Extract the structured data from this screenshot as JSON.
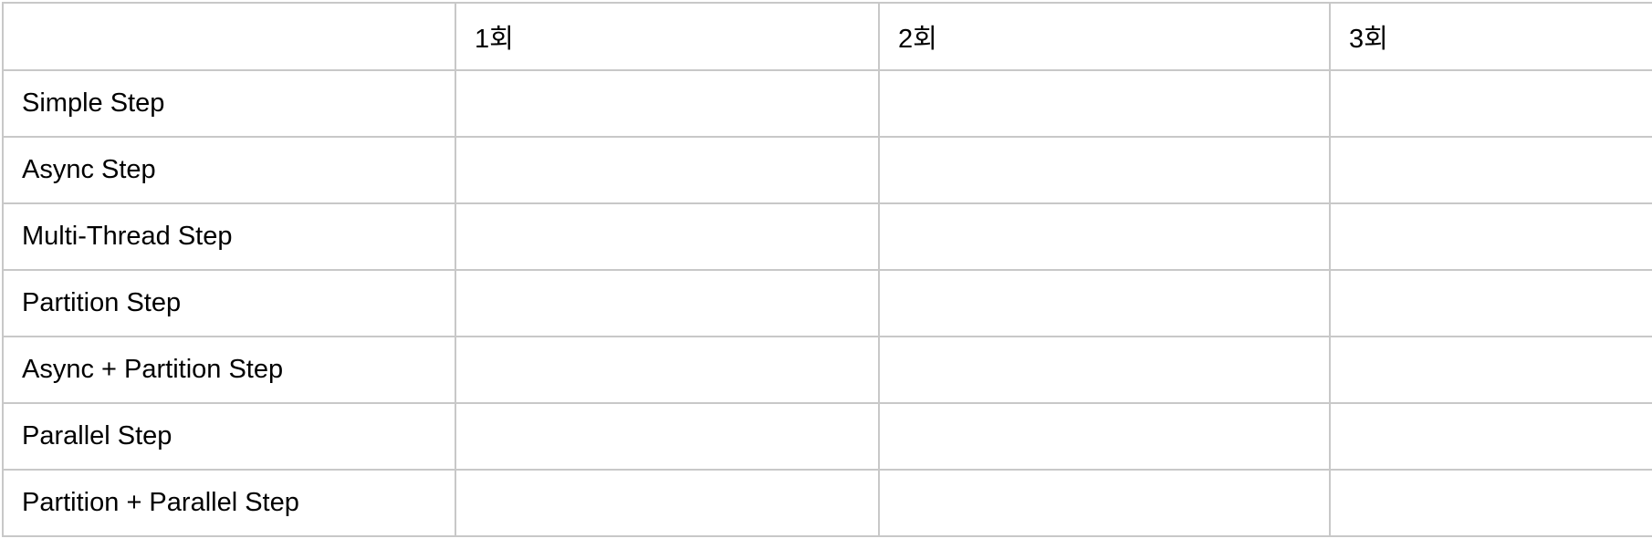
{
  "table": {
    "columns": [
      "",
      "1회",
      "2회",
      "3회"
    ],
    "rows": [
      {
        "label": "Simple Step",
        "cells": [
          "",
          "",
          ""
        ]
      },
      {
        "label": "Async Step",
        "cells": [
          "",
          "",
          ""
        ]
      },
      {
        "label": "Multi-Thread Step",
        "cells": [
          "",
          "",
          ""
        ]
      },
      {
        "label": "Partition Step",
        "cells": [
          "",
          "",
          ""
        ]
      },
      {
        "label": "Async + Partition Step",
        "cells": [
          "",
          "",
          ""
        ]
      },
      {
        "label": "Parallel Step",
        "cells": [
          "",
          "",
          ""
        ]
      },
      {
        "label": "Partition + Parallel Step",
        "cells": [
          "",
          "",
          ""
        ]
      }
    ]
  },
  "colors": {
    "border": "#c8c8c8",
    "background": "#ffffff",
    "text": "#000000"
  }
}
